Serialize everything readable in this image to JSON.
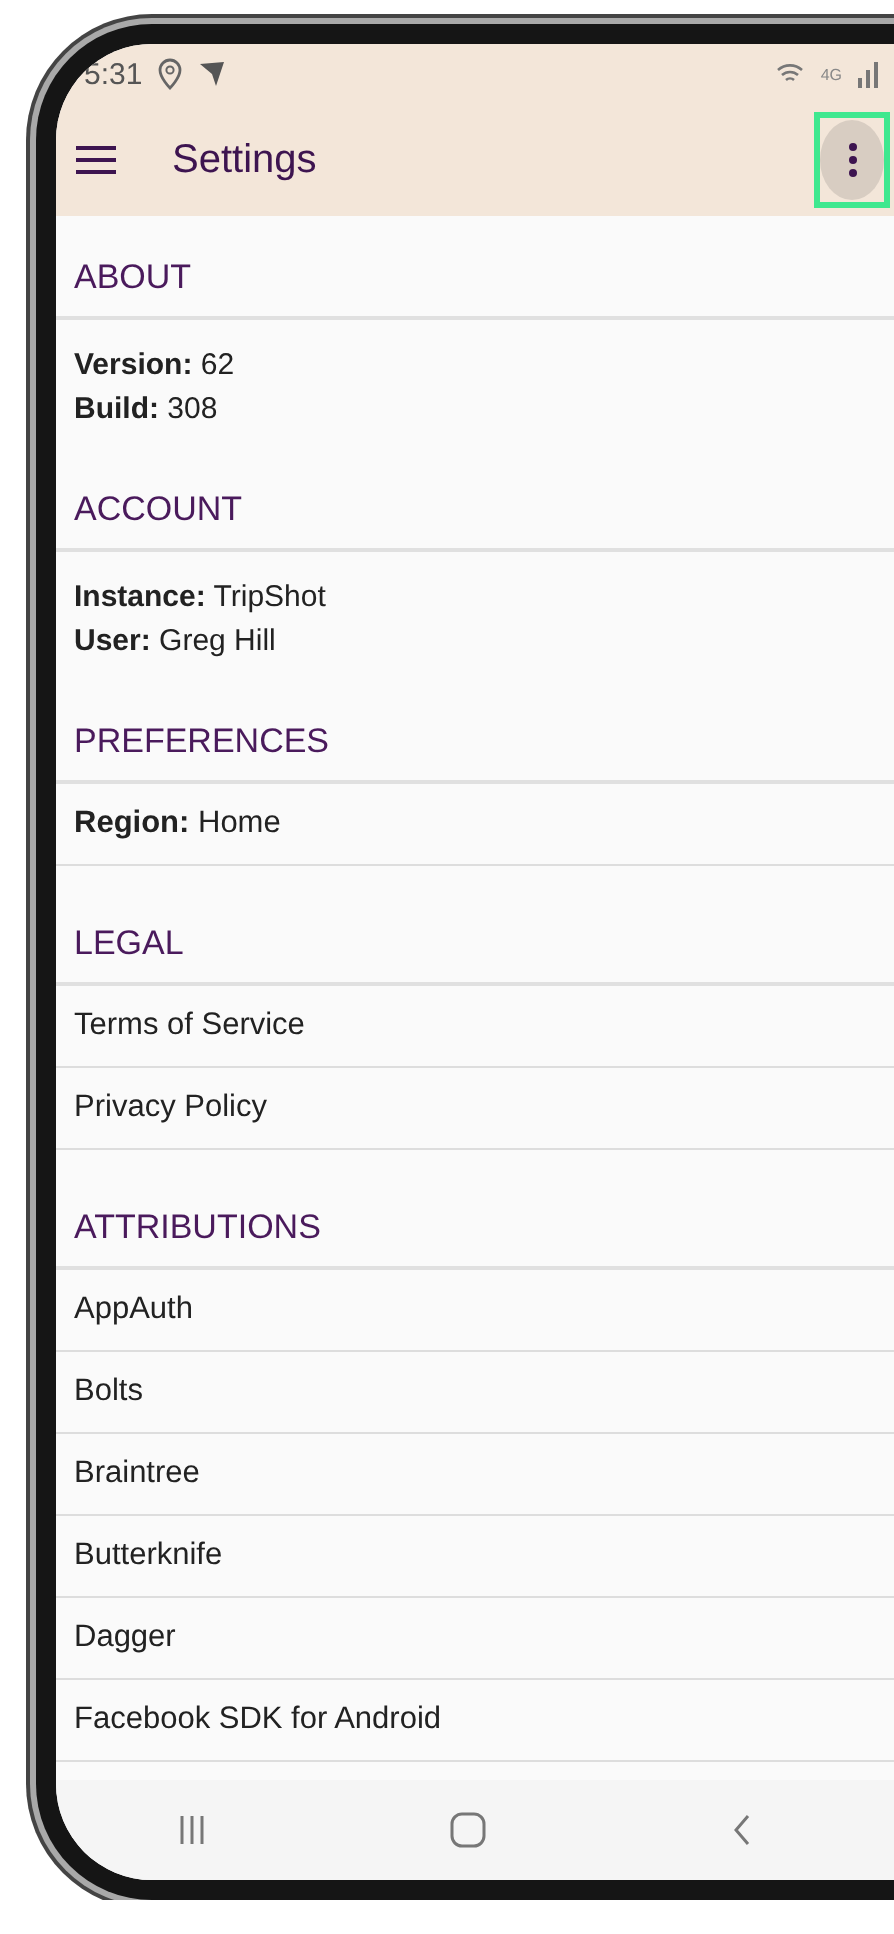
{
  "status_bar": {
    "time": "5:31",
    "network": "4G"
  },
  "app_bar": {
    "title": "Settings",
    "overflow_menu": {
      "highlighted": true
    }
  },
  "sections": [
    {
      "title": "ABOUT",
      "kind": "info",
      "lines": [
        "**Version:** 62",
        "**Build:** 308"
      ]
    },
    {
      "title": "ACCOUNT",
      "kind": "info",
      "lines": [
        "**Instance:** TripShot",
        "**User:** Greg Hill"
      ]
    },
    {
      "title": "PREFERENCES",
      "kind": "list",
      "items": [
        "**Region:** Home"
      ]
    },
    {
      "title": "LEGAL",
      "kind": "list",
      "items": [
        "Terms of Service",
        "Privacy Policy"
      ]
    },
    {
      "title": "ATTRIBUTIONS",
      "kind": "list",
      "items": [
        "AppAuth",
        "Bolts",
        "Braintree",
        "Butterknife",
        "Dagger",
        "Facebook SDK for Android"
      ]
    }
  ]
}
